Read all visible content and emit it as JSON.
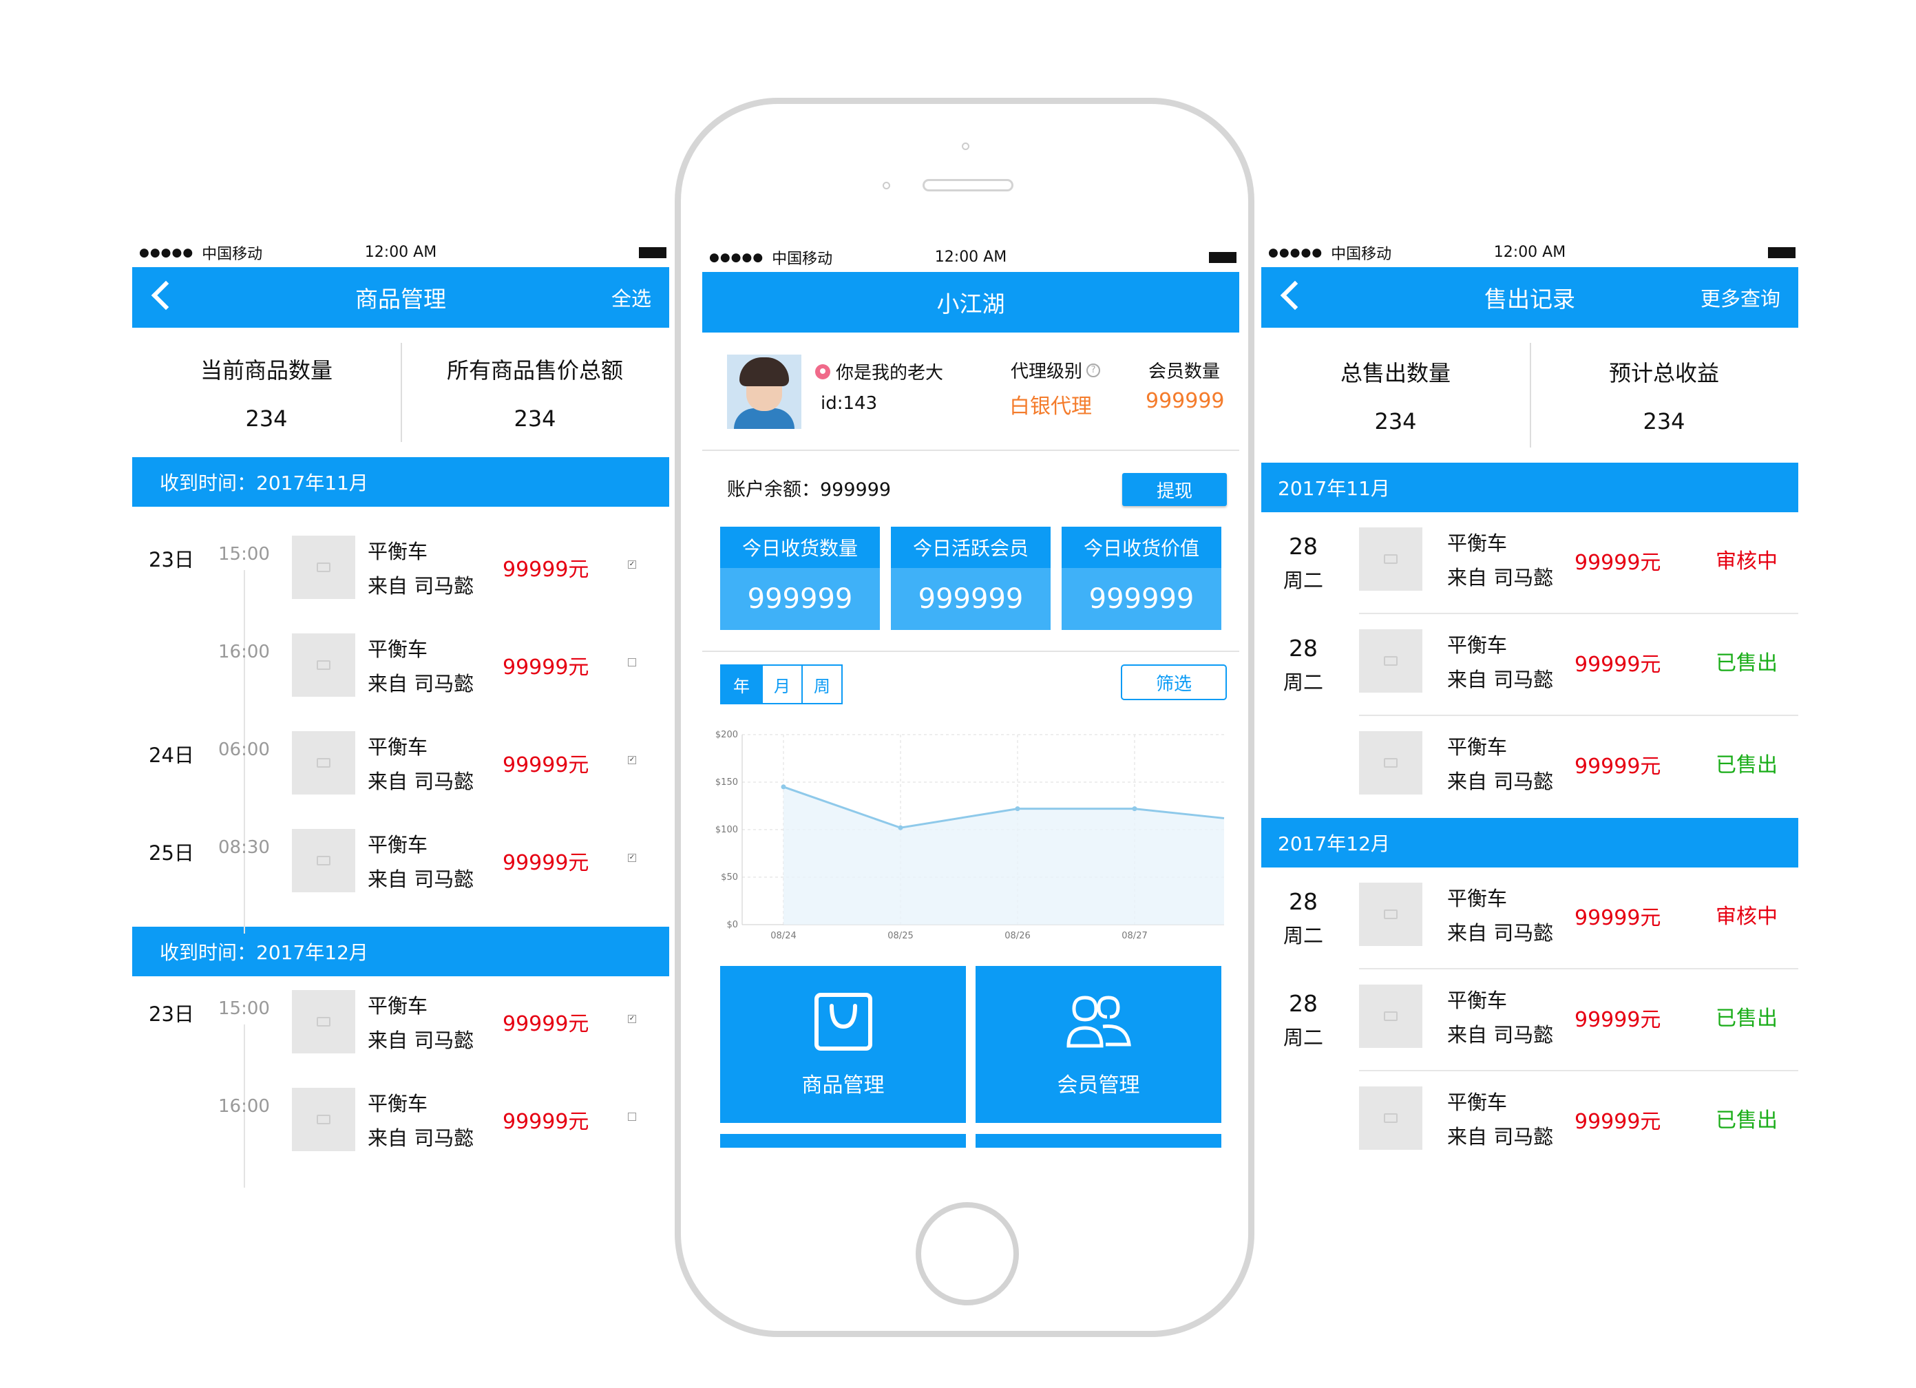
{
  "status": {
    "signal": "●●●●●",
    "carrier": "中国移动",
    "time": "12:00 AM"
  },
  "left": {
    "title": "商品管理",
    "right_action": "全选",
    "summary": [
      {
        "label": "当前商品数量",
        "value": "234"
      },
      {
        "label": "所有商品售价总额",
        "value": "234"
      }
    ],
    "sections": [
      {
        "title": "收到时间：2017年11月",
        "rows": [
          {
            "day": "23日",
            "time": "15:00",
            "name": "平衡车",
            "from": "来自 司马懿",
            "price": "99999元",
            "checked": true
          },
          {
            "day": "",
            "time": "16:00",
            "name": "平衡车",
            "from": "来自 司马懿",
            "price": "99999元",
            "checked": false
          },
          {
            "day": "24日",
            "time": "06:00",
            "name": "平衡车",
            "from": "来自 司马懿",
            "price": "99999元",
            "checked": true
          },
          {
            "day": "25日",
            "time": "08:30",
            "name": "平衡车",
            "from": "来自 司马懿",
            "price": "99999元",
            "checked": true
          }
        ]
      },
      {
        "title": "收到时间：2017年12月",
        "rows": [
          {
            "day": "23日",
            "time": "15:00",
            "name": "平衡车",
            "from": "来自 司马懿",
            "price": "99999元",
            "checked": true
          },
          {
            "day": "",
            "time": "16:00",
            "name": "平衡车",
            "from": "来自 司马懿",
            "price": "99999元",
            "checked": false
          }
        ]
      }
    ]
  },
  "center": {
    "title": "小江湖",
    "profile": {
      "name": "你是我的老大",
      "id": "id:143",
      "level_label": "代理级别",
      "level_value": "白银代理",
      "members_label": "会员数量",
      "members_value": "999999"
    },
    "balance": {
      "label": "账户余额：999999",
      "button": "提现"
    },
    "stats": [
      {
        "label": "今日收货数量",
        "value": "999999"
      },
      {
        "label": "今日活跃会员",
        "value": "999999"
      },
      {
        "label": "今日收货价值",
        "value": "999999"
      }
    ],
    "tabs": [
      "年",
      "月",
      "周"
    ],
    "filter_button": "筛选",
    "tiles": [
      {
        "label": "商品管理",
        "icon": "shopping-bag-icon"
      },
      {
        "label": "会员管理",
        "icon": "members-icon"
      }
    ]
  },
  "chart_data": {
    "type": "line",
    "x": [
      "08/24",
      "08/25",
      "08/26",
      "08/27"
    ],
    "series": [
      {
        "values": [
          145,
          102,
          122,
          122
        ]
      }
    ],
    "y_ticks": [
      "$200",
      "$150",
      "$100",
      "$50",
      "$0"
    ],
    "ylim": [
      0,
      200
    ],
    "grid": true
  },
  "right": {
    "title": "售出记录",
    "right_action": "更多查询",
    "summary": [
      {
        "label": "总售出数量",
        "value": "234"
      },
      {
        "label": "预计总收益",
        "value": "234"
      }
    ],
    "sections": [
      {
        "title": "2017年11月",
        "rows": [
          {
            "date": "28",
            "weekday": "周二",
            "name": "平衡车",
            "from": "来自 司马懿",
            "price": "99999元",
            "status": "审核中"
          },
          {
            "date": "28",
            "weekday": "周二",
            "name": "平衡车",
            "from": "来自 司马懿",
            "price": "99999元",
            "status": "已售出"
          },
          {
            "date": "",
            "weekday": "",
            "name": "平衡车",
            "from": "来自 司马懿",
            "price": "99999元",
            "status": "已售出"
          }
        ]
      },
      {
        "title": "2017年12月",
        "rows": [
          {
            "date": "28",
            "weekday": "周二",
            "name": "平衡车",
            "from": "来自 司马懿",
            "price": "99999元",
            "status": "审核中"
          },
          {
            "date": "28",
            "weekday": "周二",
            "name": "平衡车",
            "from": "来自 司马懿",
            "price": "99999元",
            "status": "已售出"
          },
          {
            "date": "",
            "weekday": "",
            "name": "平衡车",
            "from": "来自 司马懿",
            "price": "99999元",
            "status": "已售出"
          }
        ]
      }
    ]
  },
  "colors": {
    "primary": "#0c9bf5",
    "price": "#e60012",
    "sold": "#1aad19",
    "level": "#f47c2c"
  }
}
